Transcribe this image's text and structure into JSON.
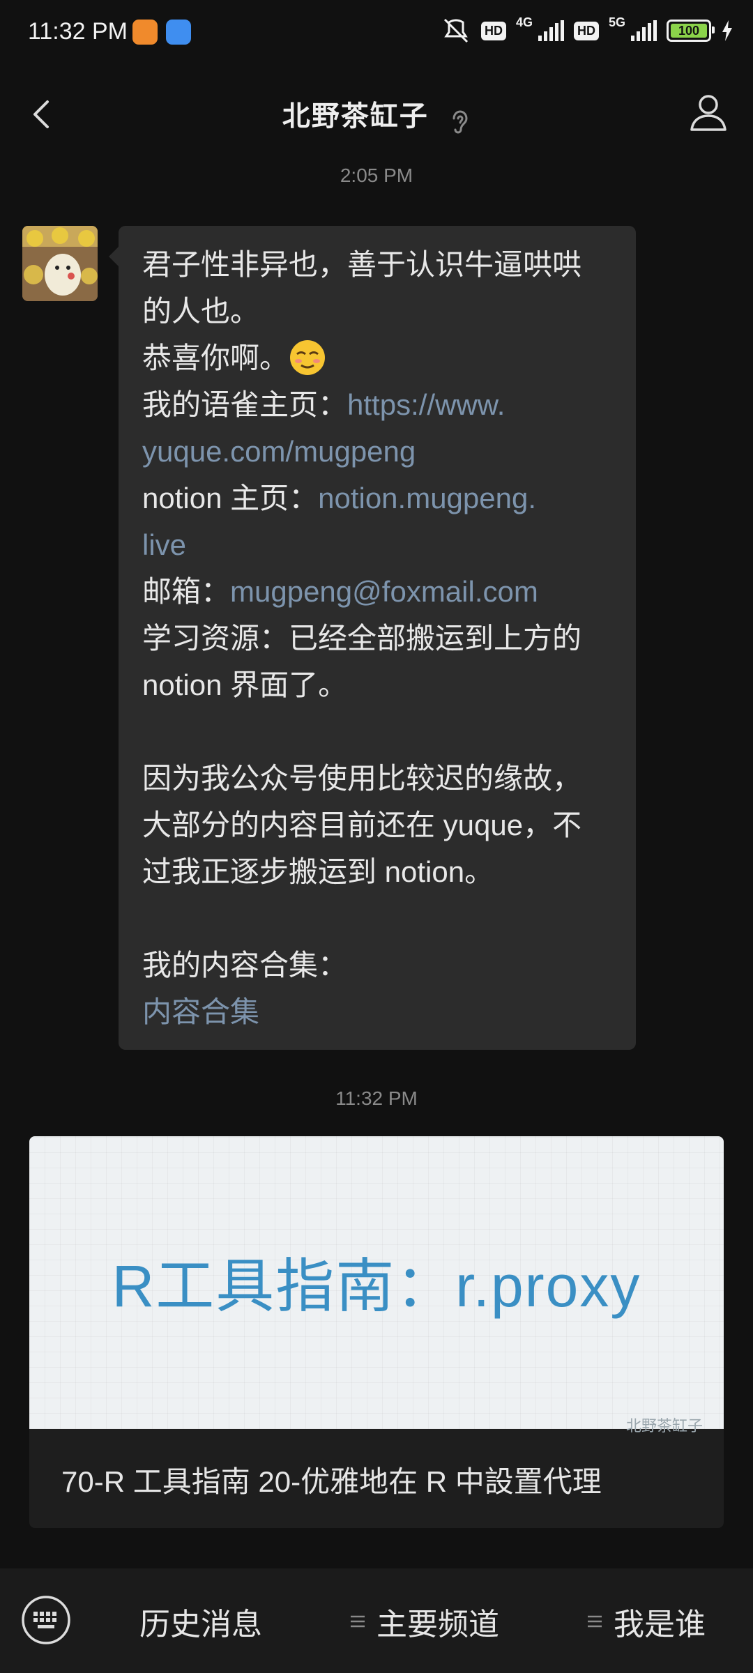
{
  "status_bar": {
    "time": "11:32 PM",
    "network_4g": "4G",
    "network_5g": "5G",
    "hd": "HD",
    "battery": "100",
    "battery_level": 1.0
  },
  "header": {
    "title": "北野茶缸子"
  },
  "chat": {
    "timestamp_1": "2:05 PM",
    "message": {
      "l1": "君子性非异也，善于认识牛逼哄哄",
      "l2": "的人也。",
      "l3": "恭喜你啊。",
      "l4_label": "我的语雀主页：",
      "l4_link": "https://www.",
      "l5_link": "yuque.com/mugpeng",
      "l6_label": "notion 主页：",
      "l6_link": "notion.mugpeng.",
      "l7_link": "live",
      "l8_label": "邮箱：",
      "l8_link": "mugpeng@foxmail.com",
      "l9": "学习资源：已经全部搬运到上方的",
      "l10": "notion 界面了。",
      "l11": "因为我公众号使用比较迟的缘故，",
      "l12": "大部分的内容目前还在 yuque，不",
      "l13": "过我正逐步搬运到 notion。",
      "l14": "我的内容合集：",
      "l15_link": "内容合集"
    },
    "timestamp_2": "11:32 PM",
    "article": {
      "image_text": "R工具指南：r.proxy",
      "watermark": "北野茶缸子",
      "title": "70-R 工具指南 20-优雅地在 R 中設置代理"
    }
  },
  "bottom_menu": {
    "items": [
      "历史消息",
      "主要频道",
      "我是谁"
    ]
  },
  "colors": {
    "background": "#111111",
    "bubble": "#2c2c2c",
    "link": "#7d94ad",
    "battery": "#8bd34a"
  }
}
